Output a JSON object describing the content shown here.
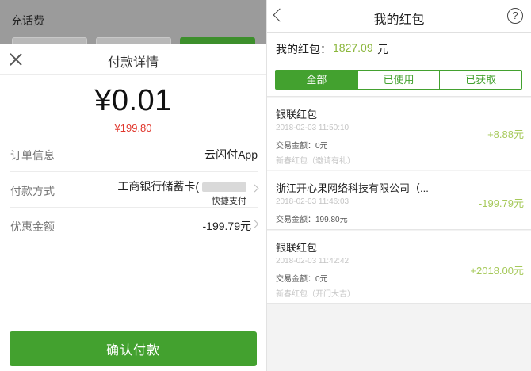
{
  "left": {
    "background": {
      "title": "充话费"
    },
    "sheet": {
      "title": "付款详情",
      "amount": "¥0.01",
      "original_amount": "¥199.80",
      "rows": {
        "order": {
          "label": "订单信息",
          "value": "云闪付App"
        },
        "payment": {
          "label": "付款方式",
          "value": "工商银行储蓄卡(",
          "sub": "快捷支付"
        },
        "discount": {
          "label": "优惠金额",
          "value": "-199.79元"
        }
      },
      "confirm_label": "确认付款"
    }
  },
  "right": {
    "nav": {
      "title": "我的红包",
      "help_glyph": "?"
    },
    "balance": {
      "label": "我的红包：",
      "value": "1827.09",
      "unit": "元"
    },
    "tabs": [
      "全部",
      "已使用",
      "已获取"
    ],
    "items": [
      {
        "title": "银联红包",
        "time": "2018-02-03 11:50:10",
        "trade": "交易金额：0元",
        "note": "新春红包（邀请有礼）",
        "amount": "+8.88元"
      },
      {
        "title": "浙江开心果网络科技有限公司（...",
        "time": "2018-02-03 11:46:03",
        "trade": "交易金额：199.80元",
        "note": "",
        "amount": "-199.79元"
      },
      {
        "title": "银联红包",
        "time": "2018-02-03 11:42:42",
        "trade": "交易金额：0元",
        "note": "新春红包（开门大吉）",
        "amount": "+2018.00元"
      }
    ]
  },
  "colors": {
    "accent_green": "#43a12f",
    "amount_green": "#a6c95a",
    "strike_red": "#e0352b"
  },
  "icons": {
    "close": "close-icon",
    "back": "back-arrow-icon",
    "help": "help-icon",
    "chevron": "chevron-right-icon"
  }
}
